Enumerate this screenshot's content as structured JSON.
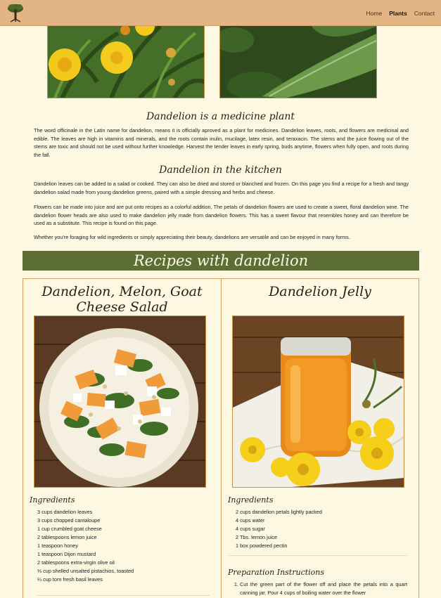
{
  "nav": {
    "home": "Home",
    "plants": "Plants",
    "contact": "Contact"
  },
  "section_medicine": {
    "heading": "Dandelion is a medicine plant",
    "text": "The word officinale in the Latin name for dandelion, means it is officially aproved as a plant for medicines. Dandelion leaves, roots, and flowers are medicinal and edible. The leaves are high in vitamins and minerals, and the roots contain inulin, mucilage, latex resin, and teraxacin. The stems and the juice flowing out of the stems are toxic and should not be used without further knowledge. Harvest the tender leaves in early spring, buds anytime, flowers when fully open, and roots during the fall."
  },
  "section_kitchen": {
    "heading": "Dandelion in the kitchen",
    "p1": "Dandelion leaves can be added to a salad or cooked. They can also be dried and stored or blanched and frozen. On this page you find a recipe for a fresh and tangy dandelion salad made from young dandelion greens, paired with a simple dressing and herbs and cheese.",
    "p2": "Flowers can be made into juice and are put onto recipes as a colorful addition. The petals of dandelion flowers are used to create a sweet, floral dandelion wine. The dandelion flower heads are also used to make dandelion jelly made from dandelion flowers. This has a sweet flavour that resembles honey and can therefore be used as a substitute. This recipe is found on this page.",
    "p3": "Whether you're foraging for wild ingredients or simply appreciating their beauty, dandelions are versatile and can be enjoyed in many forms."
  },
  "banner": "Recipes with dandelion",
  "recipe_salad": {
    "title": "Dandelion, Melon, Goat Cheese Salad",
    "ingredients_heading": "Ingredients",
    "ingredients": [
      "3 cups dandelion leaves",
      "3 cups chopped cantaloupe",
      "1 cup crumbled goat cheese",
      "2 tablespoons lemon juice",
      "1 teaspoon honey",
      "1 teaspoon Dijon mustard",
      "2 tablespoons extra-virgin olive oil",
      "⅓ cup shelled unsalted pistachios, toasted",
      "¼ cup torn fresh basil leaves"
    ]
  },
  "recipe_jelly": {
    "title": "Dandelion Jelly",
    "ingredients_heading": "Ingredients",
    "ingredients": [
      "2 cups dandelion petals lightly packed",
      "4 cups water",
      "4 cups sugar",
      "2 Tbs. lemon juice",
      "1 box powdered pectin"
    ],
    "prep_heading": "Preparation Instructions",
    "prep": [
      "Cut the green part of the flower off and place the petals into a quart canning jar. Pour 4 cups of boiling water over the flower"
    ]
  },
  "colors": {
    "header": "#e4b584",
    "background": "#fdf8e1",
    "banner": "#5c6e36",
    "border": "#d7a26a"
  }
}
